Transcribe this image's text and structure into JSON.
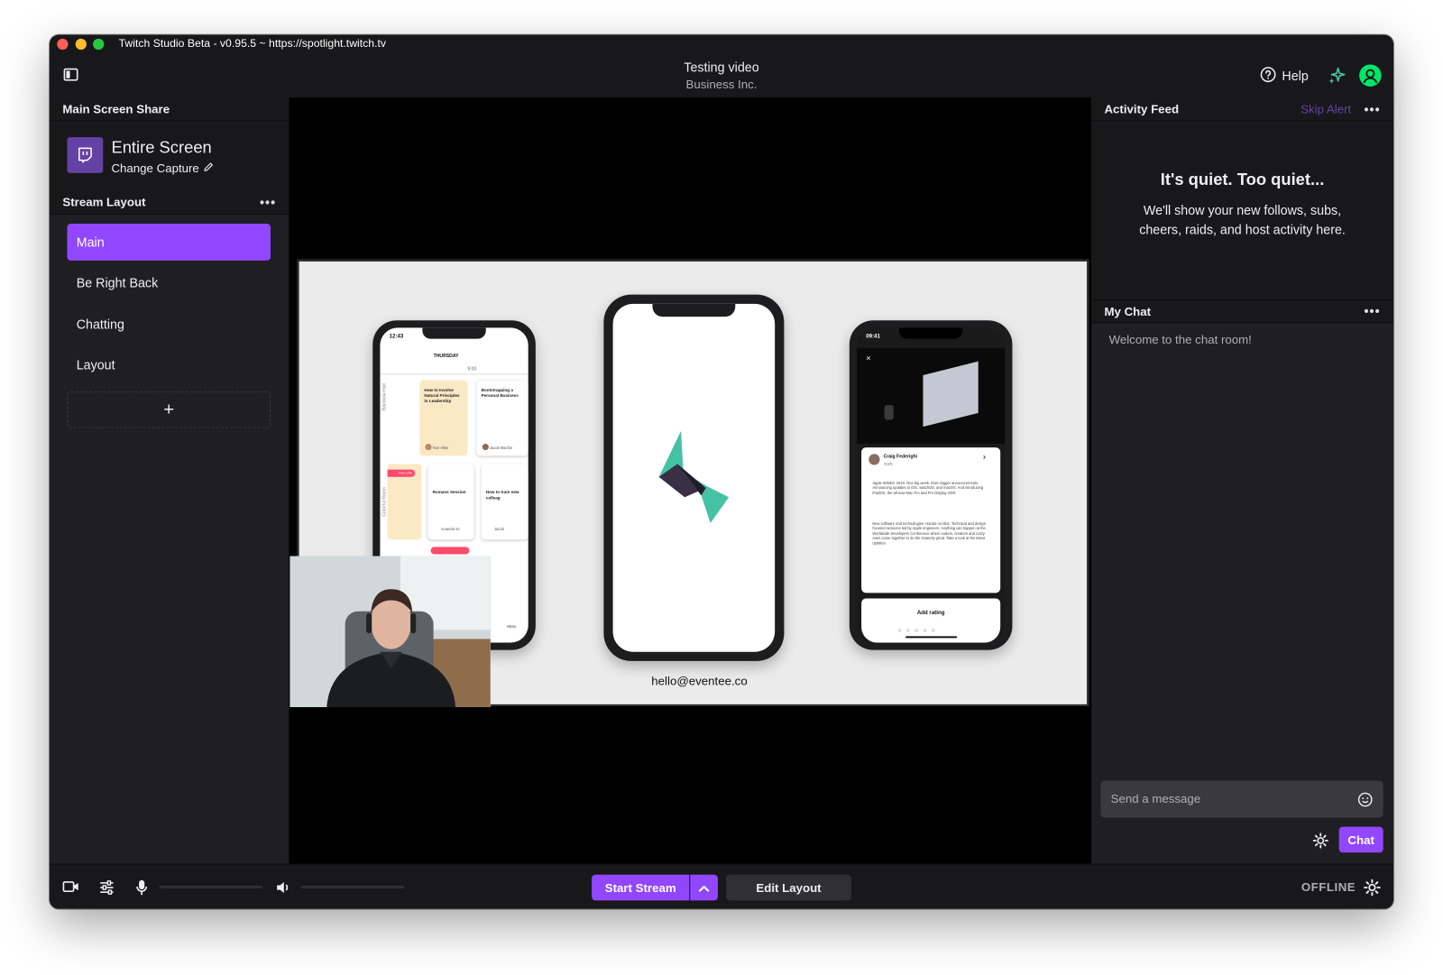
{
  "window": {
    "title": "Twitch Studio Beta - v0.95.5 ~ https://spotlight.twitch.tv"
  },
  "header": {
    "title": "Testing video",
    "subtitle": "Business Inc.",
    "help_label": "Help"
  },
  "capture": {
    "panel_title": "Main Screen Share",
    "source_name": "Entire Screen",
    "change_label": "Change Capture"
  },
  "stream_layout": {
    "panel_title": "Stream Layout",
    "items": [
      {
        "label": "Main",
        "active": true
      },
      {
        "label": "Be Right Back",
        "active": false
      },
      {
        "label": "Chatting",
        "active": false
      },
      {
        "label": "Layout",
        "active": false
      }
    ],
    "add_label": "+"
  },
  "preview": {
    "slide_caption": "hello@eventee.co",
    "phone_left": {
      "time": "12:43",
      "day": "THURSDAY",
      "hour": "9:00",
      "card1": "How to Involve Natural Principles in Leadership",
      "card1_author": "Tom Allen",
      "card2": "Bootstrapping a Personal Business",
      "card2_author": "Jacob Macfon",
      "card3": "Romans Session",
      "card3_author": "Amanda Sc",
      "card4": "How to train new colleag",
      "card4_author": "Jacob",
      "room1": "Rainbow Hall",
      "room2": "Colorful Room",
      "tag": "FOLLOW",
      "nav": "Menu"
    },
    "phone_right": {
      "time": "09:41",
      "speaker": "Craig Federighi",
      "company": "Apple",
      "para1": "Apple WWDC 2019. One big week. Even bigger announcements. Announcing updates to iOS, watchOS, and macOS. And introducing iPadOS, the all-new Mac Pro and Pro Display XDR.",
      "para2": "New software and technologies. Hands-on labs. Technical and design focused sessions led by Apple engineers. Anything can happen at the Worldwide Developers Conference where coders, creators and crazy ones come together to do the insanely great. Take a look at the latest updates.",
      "rating_label": "Add rating"
    }
  },
  "activity": {
    "panel_title": "Activity Feed",
    "skip_label": "Skip Alert",
    "empty_title": "It's quiet. Too quiet...",
    "empty_body": "We'll show your new follows, subs, cheers, raids, and host activity here."
  },
  "chat": {
    "panel_title": "My Chat",
    "welcome": "Welcome to the chat room!",
    "placeholder": "Send a message",
    "send_label": "Chat"
  },
  "bottombar": {
    "start_label": "Start Stream",
    "edit_label": "Edit Layout",
    "status": "OFFLINE",
    "mic_level": 0,
    "volume_level": 0
  },
  "colors": {
    "accent": "#9147ff",
    "background": "#18181b",
    "panel": "#1f1f23",
    "teal": "#45c1a4"
  }
}
